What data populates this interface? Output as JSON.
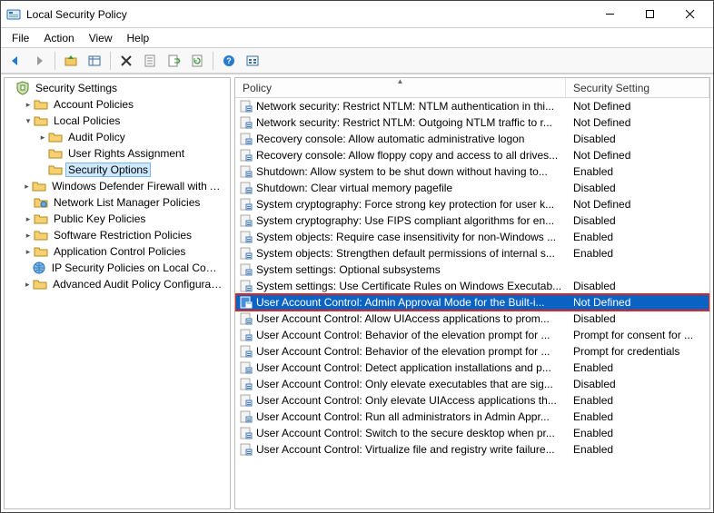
{
  "window": {
    "title": "Local Security Policy"
  },
  "menu": {
    "file": "File",
    "action": "Action",
    "view": "View",
    "help": "Help"
  },
  "tree": {
    "root": "Security Settings",
    "items": [
      {
        "label": "Account Policies",
        "depth": 1,
        "expandable": true,
        "expanded": false,
        "icon": "folder"
      },
      {
        "label": "Local Policies",
        "depth": 1,
        "expandable": true,
        "expanded": true,
        "icon": "folder"
      },
      {
        "label": "Audit Policy",
        "depth": 2,
        "expandable": true,
        "expanded": false,
        "icon": "folder"
      },
      {
        "label": "User Rights Assignment",
        "depth": 2,
        "expandable": false,
        "expanded": false,
        "icon": "folder"
      },
      {
        "label": "Security Options",
        "depth": 2,
        "expandable": false,
        "expanded": false,
        "icon": "folder",
        "selected": true
      },
      {
        "label": "Windows Defender Firewall with Adva",
        "depth": 1,
        "expandable": true,
        "expanded": false,
        "icon": "folder"
      },
      {
        "label": "Network List Manager Policies",
        "depth": 1,
        "expandable": false,
        "expanded": false,
        "icon": "folder-net"
      },
      {
        "label": "Public Key Policies",
        "depth": 1,
        "expandable": true,
        "expanded": false,
        "icon": "folder"
      },
      {
        "label": "Software Restriction Policies",
        "depth": 1,
        "expandable": true,
        "expanded": false,
        "icon": "folder"
      },
      {
        "label": "Application Control Policies",
        "depth": 1,
        "expandable": true,
        "expanded": false,
        "icon": "folder"
      },
      {
        "label": "IP Security Policies on Local Compute",
        "depth": 1,
        "expandable": false,
        "expanded": false,
        "icon": "ipsec"
      },
      {
        "label": "Advanced Audit Policy Configuration",
        "depth": 1,
        "expandable": true,
        "expanded": false,
        "icon": "folder"
      }
    ]
  },
  "list": {
    "headers": {
      "policy": "Policy",
      "setting": "Security Setting"
    },
    "rows": [
      {
        "policy": "Network security: Restrict NTLM: NTLM authentication in thi...",
        "setting": "Not Defined"
      },
      {
        "policy": "Network security: Restrict NTLM: Outgoing NTLM traffic to r...",
        "setting": "Not Defined"
      },
      {
        "policy": "Recovery console: Allow automatic administrative logon",
        "setting": "Disabled"
      },
      {
        "policy": "Recovery console: Allow floppy copy and access to all drives...",
        "setting": "Not Defined"
      },
      {
        "policy": "Shutdown: Allow system to be shut down without having to...",
        "setting": "Enabled"
      },
      {
        "policy": "Shutdown: Clear virtual memory pagefile",
        "setting": "Disabled"
      },
      {
        "policy": "System cryptography: Force strong key protection for user k...",
        "setting": "Not Defined"
      },
      {
        "policy": "System cryptography: Use FIPS compliant algorithms for en...",
        "setting": "Disabled"
      },
      {
        "policy": "System objects: Require case insensitivity for non-Windows ...",
        "setting": "Enabled"
      },
      {
        "policy": "System objects: Strengthen default permissions of internal s...",
        "setting": "Enabled"
      },
      {
        "policy": "System settings: Optional subsystems",
        "setting": ""
      },
      {
        "policy": "System settings: Use Certificate Rules on Windows Executab...",
        "setting": "Disabled"
      },
      {
        "policy": "User Account Control: Admin Approval Mode for the Built-i...",
        "setting": "Not Defined",
        "selected": true
      },
      {
        "policy": "User Account Control: Allow UIAccess applications to prom...",
        "setting": "Disabled"
      },
      {
        "policy": "User Account Control: Behavior of the elevation prompt for ...",
        "setting": "Prompt for consent for ..."
      },
      {
        "policy": "User Account Control: Behavior of the elevation prompt for ...",
        "setting": "Prompt for credentials"
      },
      {
        "policy": "User Account Control: Detect application installations and p...",
        "setting": "Enabled"
      },
      {
        "policy": "User Account Control: Only elevate executables that are sig...",
        "setting": "Disabled"
      },
      {
        "policy": "User Account Control: Only elevate UIAccess applications th...",
        "setting": "Enabled"
      },
      {
        "policy": "User Account Control: Run all administrators in Admin Appr...",
        "setting": "Enabled"
      },
      {
        "policy": "User Account Control: Switch to the secure desktop when pr...",
        "setting": "Enabled"
      },
      {
        "policy": "User Account Control: Virtualize file and registry write failure...",
        "setting": "Enabled"
      }
    ]
  }
}
